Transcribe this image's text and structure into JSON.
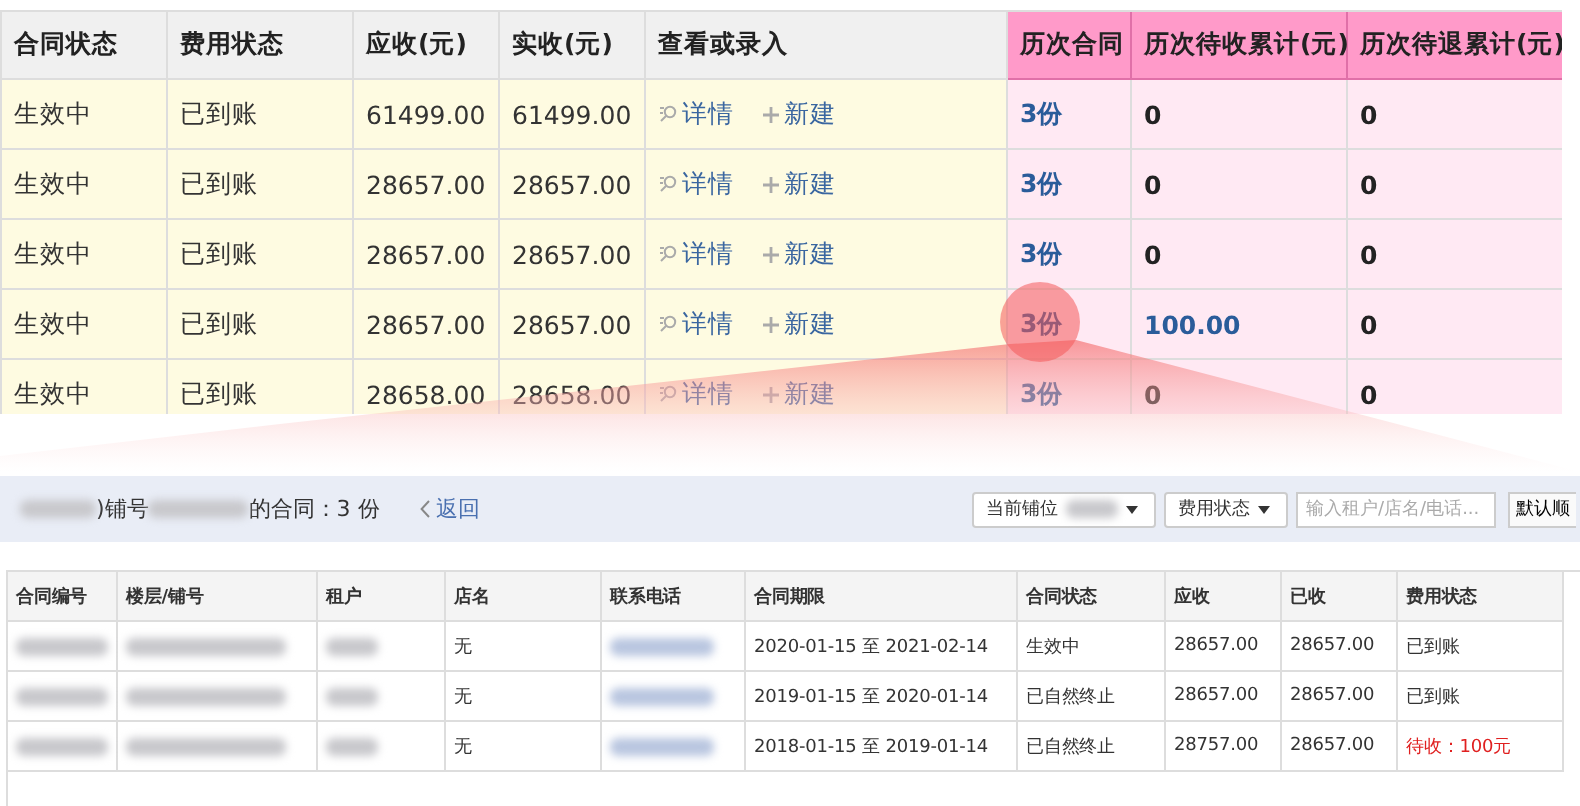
{
  "summary_table": {
    "columns": [
      {
        "label": "合同状态",
        "pink": false
      },
      {
        "label": "费用状态",
        "pink": false
      },
      {
        "label": "应收(元)",
        "pink": false
      },
      {
        "label": "实收(元)",
        "pink": false
      },
      {
        "label": "查看或录入",
        "pink": false
      },
      {
        "label": "历次合同",
        "pink": true
      },
      {
        "label": "历次待收累计(元)",
        "pink": true
      },
      {
        "label": "历次待退累计(元)",
        "pink": true
      }
    ],
    "rows": [
      {
        "contract_status": "生效中",
        "fee_status": "已到账",
        "receivable": "61499.00",
        "received": "61499.00",
        "detail": "详情",
        "create": "新建",
        "history": "3份",
        "pending": "0",
        "pending_due": false,
        "refund": "0"
      },
      {
        "contract_status": "生效中",
        "fee_status": "已到账",
        "receivable": "28657.00",
        "received": "28657.00",
        "detail": "详情",
        "create": "新建",
        "history": "3份",
        "pending": "0",
        "pending_due": false,
        "refund": "0"
      },
      {
        "contract_status": "生效中",
        "fee_status": "已到账",
        "receivable": "28657.00",
        "received": "28657.00",
        "detail": "详情",
        "create": "新建",
        "history": "3份",
        "pending": "0",
        "pending_due": false,
        "refund": "0"
      },
      {
        "contract_status": "生效中",
        "fee_status": "已到账",
        "receivable": "28657.00",
        "received": "28657.00",
        "detail": "详情",
        "create": "新建",
        "history": "3份",
        "pending": "100.00",
        "pending_due": true,
        "refund": "0"
      },
      {
        "contract_status": "生效中",
        "fee_status": "已到账",
        "receivable": "28658.00",
        "received": "28658.00",
        "detail": "详情",
        "create": "新建",
        "history": "3份",
        "pending": "0",
        "pending_due": false,
        "refund": "0"
      }
    ]
  },
  "detail_panel": {
    "title_parts": [
      ")铺号",
      "的合同：3 份"
    ],
    "back_link": "返回",
    "filters": {
      "shop_select": "当前铺位",
      "fee_select": "费用状态",
      "search": {
        "placeholder": "输入租户/店名/电话..."
      },
      "sort_button": "默认顺"
    },
    "columns": [
      "合同编号",
      "楼层/铺号",
      "租户",
      "店名",
      "联系电话",
      "合同期限",
      "合同状态",
      "应收",
      "已收",
      "费用状态"
    ],
    "rows": [
      {
        "shop_name": "无",
        "term": "2020-01-15 至 2021-02-14",
        "status": "生效中",
        "receivable": "28657.00",
        "received": "28657.00",
        "fee_status": "已到账",
        "overdue": false
      },
      {
        "shop_name": "无",
        "term": "2019-01-15 至 2020-01-14",
        "status": "已自然终止",
        "receivable": "28657.00",
        "received": "28657.00",
        "fee_status": "已到账",
        "overdue": false
      },
      {
        "shop_name": "无",
        "term": "2018-01-15 至 2019-01-14",
        "status": "已自然终止",
        "receivable": "28757.00",
        "received": "28657.00",
        "fee_status": "待收：100元",
        "overdue": true
      }
    ]
  }
}
